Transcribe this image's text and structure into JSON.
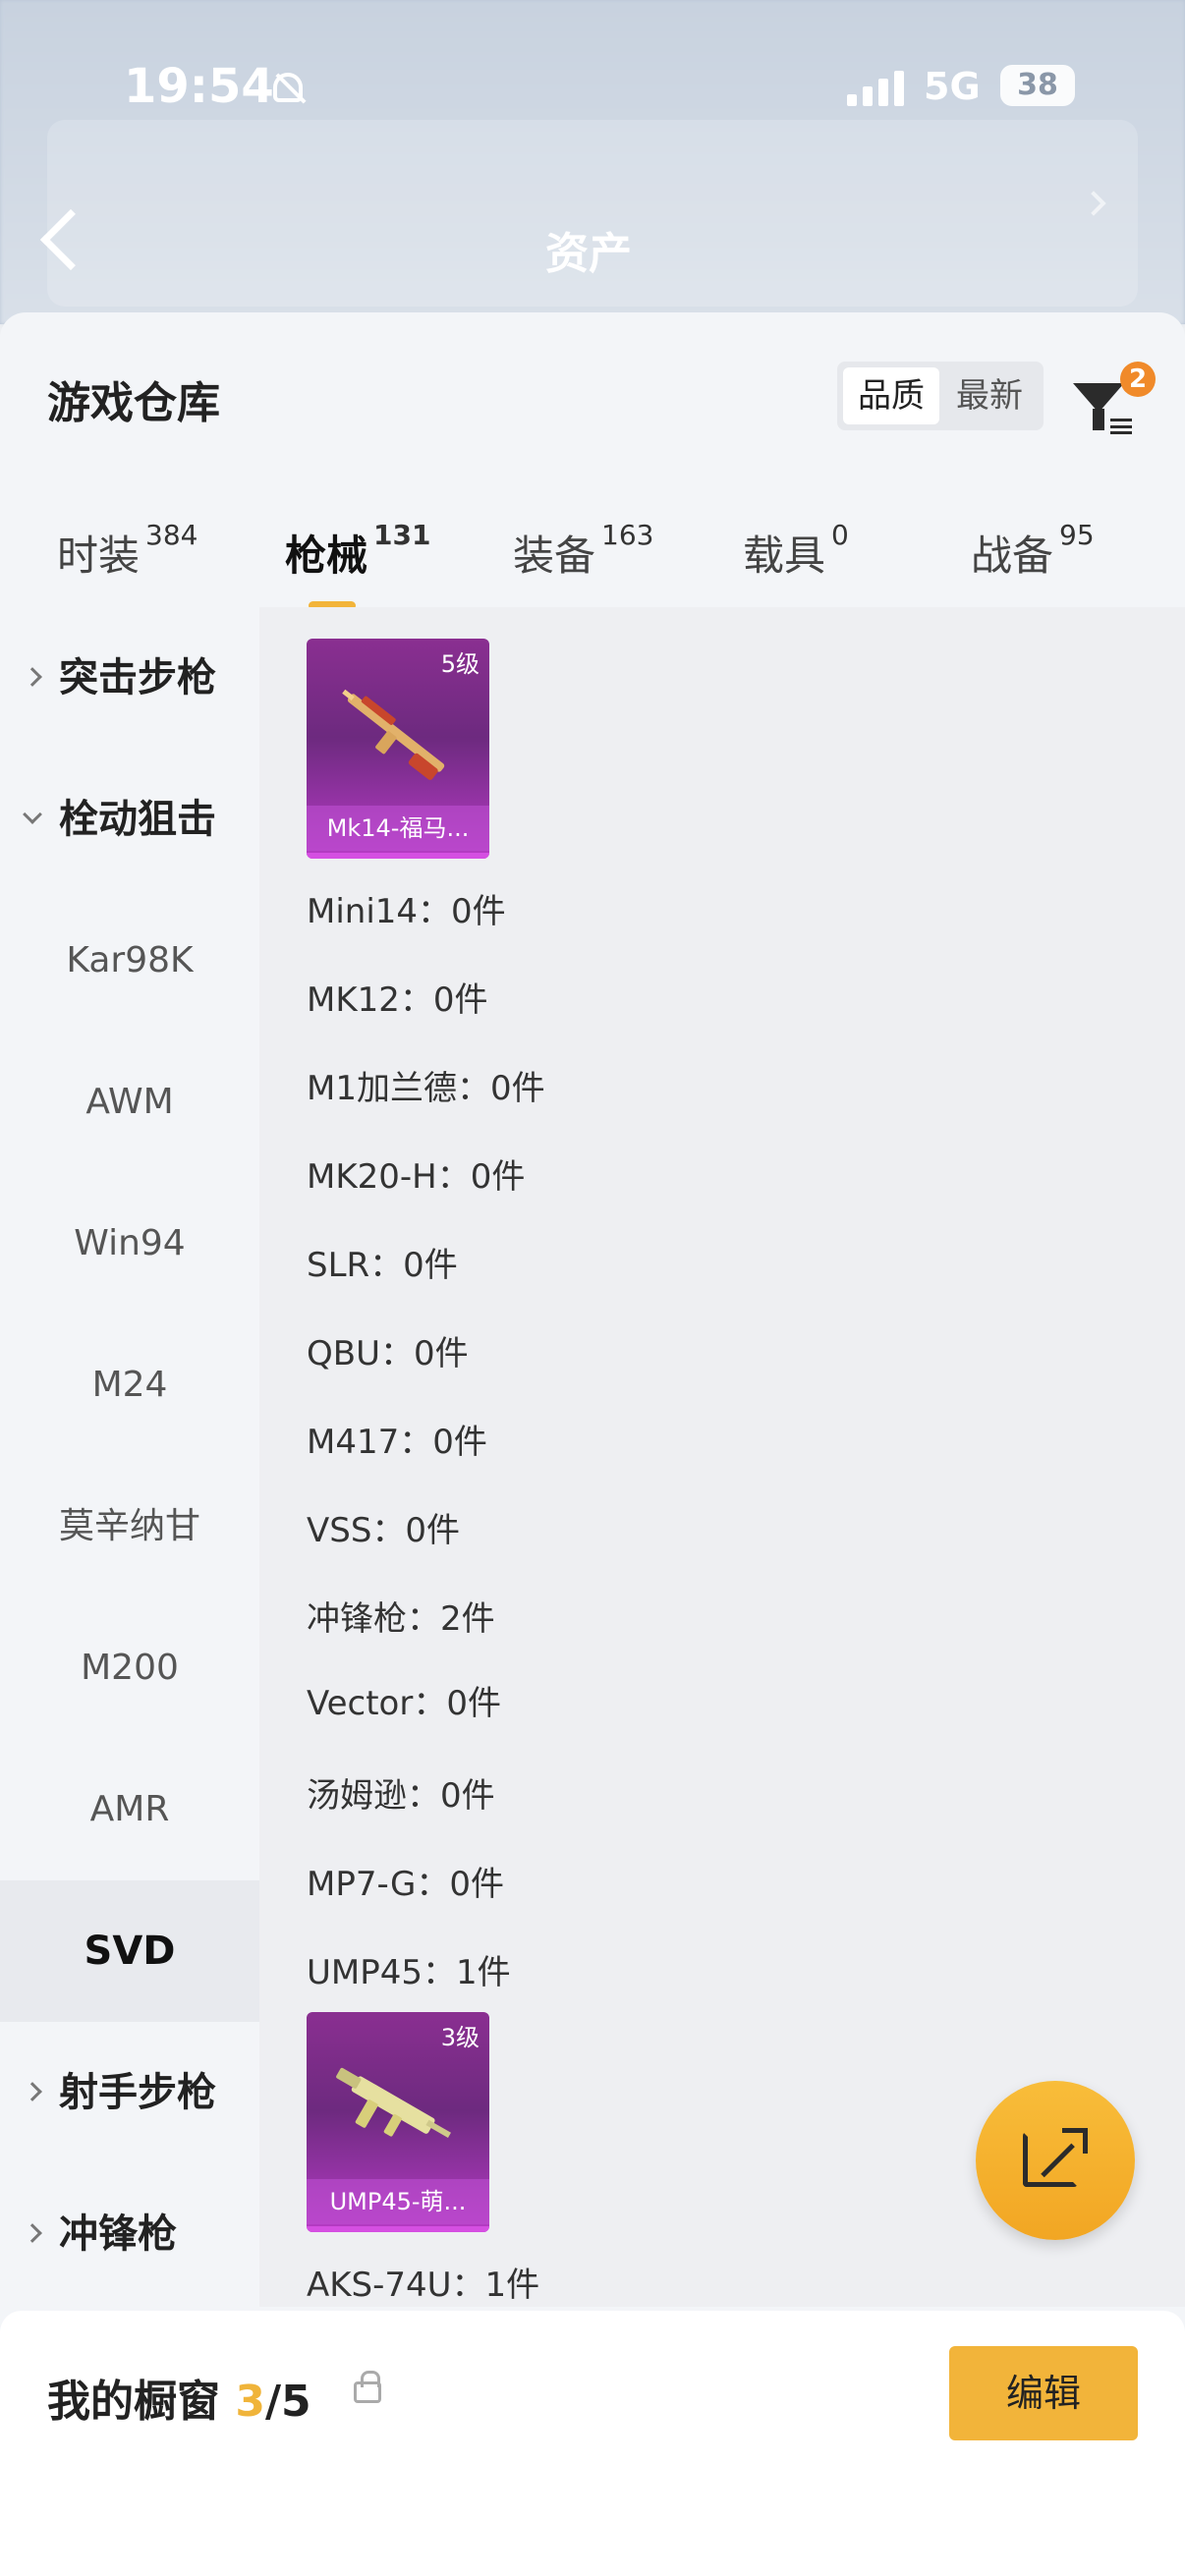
{
  "status_bar": {
    "time": "19:54",
    "network": "5G",
    "battery": "38"
  },
  "header": {
    "title": "资产"
  },
  "warehouse": {
    "title": "游戏仓库",
    "sort_options": [
      "品质",
      "最新"
    ],
    "filter_count": "2"
  },
  "tabs": [
    {
      "label": "时装",
      "count": "384"
    },
    {
      "label": "枪械",
      "count": "131",
      "active": true
    },
    {
      "label": "装备",
      "count": "163"
    },
    {
      "label": "载具",
      "count": "0"
    },
    {
      "label": "战备",
      "count": "95"
    }
  ],
  "nav": {
    "groups": [
      "突击步枪",
      "栓动狙击",
      "射手步枪",
      "冲锋枪"
    ],
    "items": [
      "Kar98K",
      "AWM",
      "Win94",
      "M24",
      "莫辛纳甘",
      "M200",
      "AMR",
      "SVD"
    ],
    "selected": "SVD"
  },
  "content": {
    "card1": {
      "level": "5级",
      "name": "Mk14-福马..."
    },
    "rows": [
      "Mini14：0件",
      "MK12：0件",
      "M1加兰德：0件",
      "MK20-H：0件",
      "SLR：0件",
      "QBU：0件",
      "M417：0件",
      "VSS：0件",
      "冲锋枪：2件",
      "Vector：0件",
      "汤姆逊：0件",
      "MP7-G：0件",
      "UMP45：1件"
    ],
    "card2": {
      "level": "3级",
      "name": "UMP45-萌..."
    },
    "last_row": "AKS-74U：1件"
  },
  "showcase": {
    "label": "我的橱窗",
    "current": "3",
    "sep_total": "/5",
    "edit_label": "编辑"
  },
  "colors": {
    "accent": "#f2b43a",
    "card_purple": "#8a2f91",
    "badge_orange": "#f08a2a"
  }
}
